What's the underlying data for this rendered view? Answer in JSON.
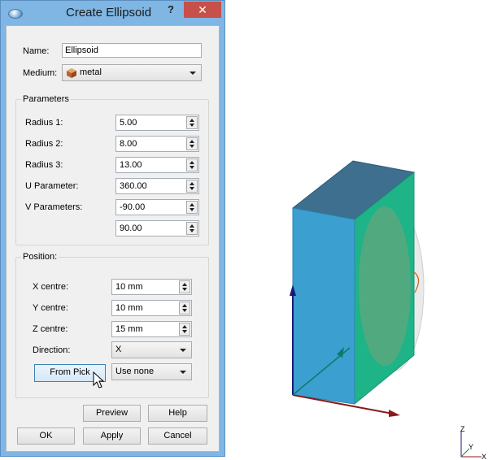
{
  "window": {
    "title": "Create Ellipsoid",
    "help_label": "?",
    "close_label": "✕"
  },
  "form": {
    "name_label": "Name:",
    "name_value": "Ellipsoid",
    "medium_label": "Medium:",
    "medium_value": "metal"
  },
  "parameters": {
    "title": "Parameters",
    "rows": [
      {
        "label": "Radius 1:",
        "value": "5.00"
      },
      {
        "label": "Radius 2:",
        "value": "8.00"
      },
      {
        "label": "Radius 3:",
        "value": "13.00"
      },
      {
        "label": "U Parameter:",
        "value": "360.00"
      },
      {
        "label": "V Parameters:",
        "value": "-90.00"
      },
      {
        "label": "",
        "value": "90.00"
      }
    ]
  },
  "position": {
    "title": "Position:",
    "x_label": "X centre:",
    "x_value": "10 mm",
    "y_label": "Y centre:",
    "y_value": "10 mm",
    "z_label": "Z centre:",
    "z_value": "15 mm",
    "direction_label": "Direction:",
    "direction_value": "X",
    "from_pick_label": "From Pick",
    "pick_mode_value": "Use none"
  },
  "buttons": {
    "preview": "Preview",
    "help": "Help",
    "ok": "OK",
    "apply": "Apply",
    "cancel": "Cancel"
  },
  "axes": {
    "z": "Z",
    "y": "Y",
    "x": "X"
  },
  "colors": {
    "box_front": "#3b9fcf",
    "box_side": "#1fb388",
    "box_top": "#3e6f8e",
    "ellipsoid": "#5aa87e",
    "axis_z": "#1a1a7a",
    "axis_x": "#8a1a1a"
  }
}
